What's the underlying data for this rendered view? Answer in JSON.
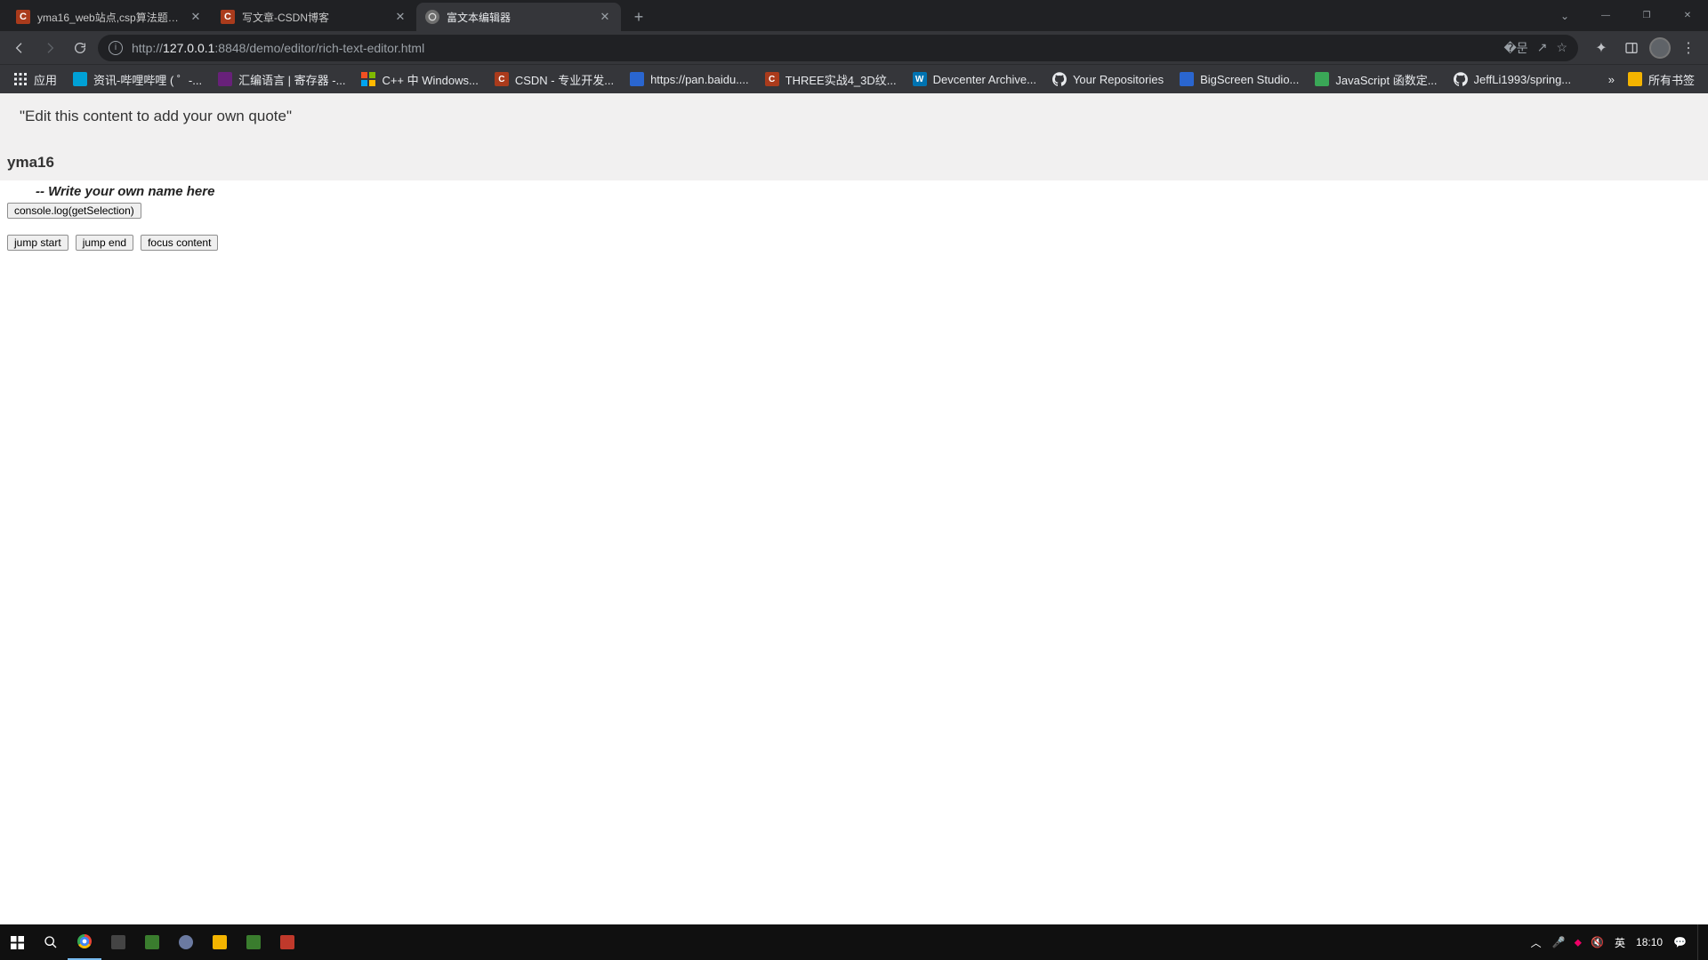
{
  "tabs": [
    {
      "title": "yma16_web站点,csp算法题目,C...",
      "favicon_letter": "C",
      "favicon_bg": "#aa3b1c",
      "active": false
    },
    {
      "title": "写文章-CSDN博客",
      "favicon_letter": "C",
      "favicon_bg": "#aa3b1c",
      "active": false
    },
    {
      "title": "富文本编辑器",
      "favicon_letter": "",
      "favicon_bg": "#6e6e6e",
      "active": true
    }
  ],
  "url": {
    "scheme": "http://",
    "host": "127.0.0.1",
    "rest": ":8848/demo/editor/rich-text-editor.html"
  },
  "bookmarks": [
    {
      "label": "应用",
      "icon_bg": "#000",
      "icon_svg": "apps"
    },
    {
      "label": "资讯-哔哩哔哩 ( ゜-...",
      "icon_bg": "#00a1d6",
      "text": ""
    },
    {
      "label": "汇编语言 | 寄存器 -...",
      "icon_bg": "#68217a",
      "text": ""
    },
    {
      "label": "C++ 中 Windows...",
      "icon_bg": "#000",
      "icon_svg": "ms"
    },
    {
      "label": "CSDN - 专业开发...",
      "icon_bg": "#aa3b1c",
      "text": "C"
    },
    {
      "label": "https://pan.baidu....",
      "icon_bg": "#2a66d0",
      "text": ""
    },
    {
      "label": "THREE实战4_3D纹...",
      "icon_bg": "#aa3b1c",
      "text": "C"
    },
    {
      "label": "Devcenter Archive...",
      "icon_bg": "#0073b1",
      "text": "W"
    },
    {
      "label": "Your Repositories",
      "icon_bg": "#000",
      "icon_svg": "gh"
    },
    {
      "label": "BigScreen Studio...",
      "icon_bg": "#2a66d0",
      "text": ""
    },
    {
      "label": "JavaScript 函数定...",
      "icon_bg": "#3aa757",
      "text": ""
    },
    {
      "label": "JeffLi1993/spring...",
      "icon_bg": "#000",
      "icon_svg": "gh"
    }
  ],
  "bookmarks_overflow": "»",
  "bookmarks_all": "所有书签",
  "page": {
    "quote": "\"Edit this content to add your own quote\"",
    "author": "yma16",
    "placeholder": "-- Write your own name here",
    "btn_console": "console.log(getSelection)",
    "btn_jump_start": "jump start",
    "btn_jump_end": "jump end",
    "btn_focus_content": "focus content"
  },
  "taskbar": {
    "ime": "英",
    "clock": "18:10"
  }
}
